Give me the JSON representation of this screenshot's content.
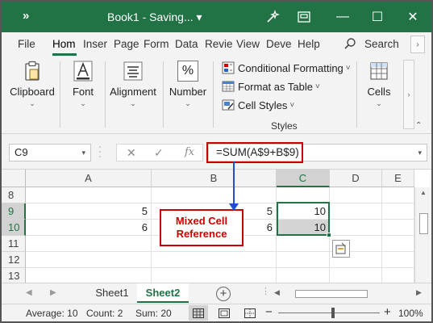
{
  "window": {
    "title": "Book1 - Saving...",
    "title_caret": "▾",
    "minimize": "—",
    "maximize": "☐",
    "close": "✕"
  },
  "tabs": {
    "items": [
      "File",
      "Hom",
      "Inser",
      "Page",
      "Form",
      "Data",
      "Revie",
      "View",
      "Deve",
      "Help"
    ],
    "active_index": 1,
    "search_label": "Search",
    "scroll_right": "›"
  },
  "ribbon": {
    "clipboard": "Clipboard",
    "font": "Font",
    "alignment": "Alignment",
    "number": "Number",
    "number_icon": "%",
    "conditional_formatting": "Conditional Formatting",
    "format_as_table": "Format as Table",
    "cell_styles": "Cell Styles",
    "styles_group": "Styles",
    "cells": "Cells",
    "caret": "⌄",
    "item_caret": "˅"
  },
  "formula_bar": {
    "name_box": "C9",
    "name_caret": "▾",
    "cancel": "✕",
    "enter": "✓",
    "fx": "fx",
    "formula": "=SUM(A$9+B$9)",
    "formula_caret": "▾"
  },
  "grid": {
    "columns": [
      "A",
      "B",
      "C",
      "D",
      "E"
    ],
    "selected_column": "C",
    "rows": [
      {
        "num": "8",
        "A": "",
        "B": "",
        "C": "",
        "selected": false
      },
      {
        "num": "9",
        "A": "5",
        "B": "5",
        "C": "10",
        "selected": true
      },
      {
        "num": "10",
        "A": "6",
        "B": "6",
        "C": "10",
        "selected": true
      },
      {
        "num": "11",
        "A": "",
        "B": "",
        "C": "",
        "selected": false
      },
      {
        "num": "12",
        "A": "",
        "B": "",
        "C": "",
        "selected": false
      },
      {
        "num": "13",
        "A": "",
        "B": "",
        "C": "",
        "selected": false
      }
    ]
  },
  "callout": {
    "line1": "Mixed Cell",
    "line2": "Reference"
  },
  "sheets": {
    "tabs": [
      "Sheet1",
      "Sheet2"
    ],
    "active": "Sheet2",
    "add": "+",
    "nav_prev": "◀",
    "nav_next": "▶",
    "dots": "⋮"
  },
  "status": {
    "average": "Average: 10",
    "count": "Count: 2",
    "sum": "Sum: 20",
    "zoom_minus": "−",
    "zoom_plus": "+",
    "zoom": "100%",
    "zoom_level": 1.0
  },
  "colors": {
    "accent": "#217346",
    "annotation": "#cc0000",
    "arrow": "#1f4fd1"
  }
}
